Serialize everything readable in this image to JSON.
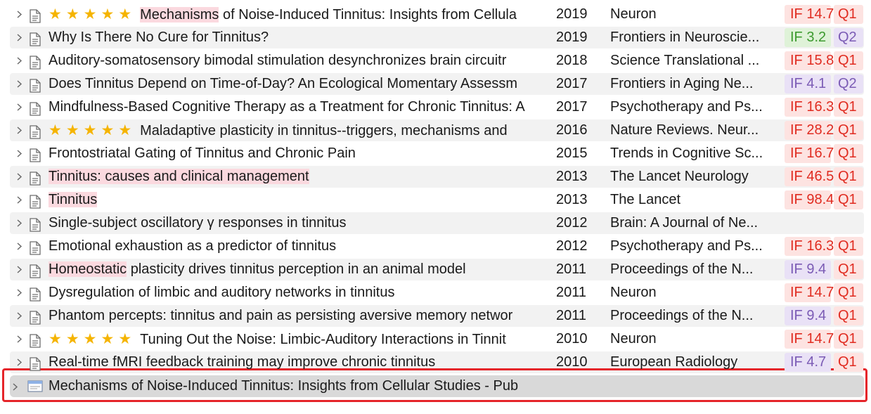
{
  "rows": [
    {
      "stars": 5,
      "title_hl": "Mechanisms",
      "title_rest": " of Noise-Induced Tinnitus: Insights from Cellula",
      "year": "2019",
      "journal": "Neuron",
      "if": "IF 14.7",
      "if_color": "red",
      "q": "Q1",
      "q_color": "red"
    },
    {
      "stars": 0,
      "title_hl": "",
      "title_rest": "Why Is There No Cure for Tinnitus?",
      "year": "2019",
      "journal": "Frontiers in Neuroscie...",
      "if": "IF 3.2",
      "if_color": "green",
      "q": "Q2",
      "q_color": "purple"
    },
    {
      "stars": 0,
      "title_hl": "",
      "title_rest": "Auditory-somatosensory bimodal stimulation desynchronizes brain circuitr",
      "year": "2018",
      "journal": "Science Translational ...",
      "if": "IF 15.8",
      "if_color": "red",
      "q": "Q1",
      "q_color": "red"
    },
    {
      "stars": 0,
      "title_hl": "",
      "title_rest": "Does Tinnitus Depend on Time-of-Day? An Ecological Momentary Assessm",
      "year": "2017",
      "journal": "Frontiers in Aging Ne...",
      "if": "IF 4.1",
      "if_color": "purple",
      "q": "Q2",
      "q_color": "purple"
    },
    {
      "stars": 0,
      "title_hl": "",
      "title_rest": "Mindfulness-Based Cognitive Therapy as a Treatment for Chronic Tinnitus: A",
      "year": "2017",
      "journal": "Psychotherapy and Ps...",
      "if": "IF 16.3",
      "if_color": "red",
      "q": "Q1",
      "q_color": "red"
    },
    {
      "stars": 5,
      "title_hl": "",
      "title_rest": "Maladaptive plasticity in tinnitus--triggers, mechanisms and",
      "year": "2016",
      "journal": "Nature Reviews. Neur...",
      "if": "IF 28.2",
      "if_color": "red",
      "q": "Q1",
      "q_color": "red"
    },
    {
      "stars": 0,
      "title_hl": "",
      "title_rest": "Frontostriatal Gating of Tinnitus and Chronic Pain",
      "year": "2015",
      "journal": "Trends in Cognitive Sc...",
      "if": "IF 16.7",
      "if_color": "red",
      "q": "Q1",
      "q_color": "red"
    },
    {
      "stars": 0,
      "title_hl": "Tinnitus: causes and clinical management",
      "title_rest": "",
      "year": "2013",
      "journal": "The Lancet Neurology",
      "if": "IF 46.5",
      "if_color": "red",
      "q": "Q1",
      "q_color": "red"
    },
    {
      "stars": 0,
      "title_hl": "Tinnitus",
      "title_rest": "",
      "year": "2013",
      "journal": "The Lancet",
      "if": "IF 98.4",
      "if_color": "red",
      "q": "Q1",
      "q_color": "red"
    },
    {
      "stars": 0,
      "title_hl": "",
      "title_rest": "Single-subject oscillatory γ responses in tinnitus",
      "year": "2012",
      "journal": "Brain: A Journal of Ne...",
      "if": "",
      "if_color": "",
      "q": "",
      "q_color": ""
    },
    {
      "stars": 0,
      "title_hl": "",
      "title_rest": "Emotional exhaustion as a predictor of tinnitus",
      "year": "2012",
      "journal": "Psychotherapy and Ps...",
      "if": "IF 16.3",
      "if_color": "red",
      "q": "Q1",
      "q_color": "red"
    },
    {
      "stars": 0,
      "title_hl": "Homeostatic",
      "title_rest": " plasticity drives tinnitus perception in an animal model",
      "year": "2011",
      "journal": "Proceedings of the N...",
      "if": "IF 9.4",
      "if_color": "purple",
      "q": "Q1",
      "q_color": "red"
    },
    {
      "stars": 0,
      "title_hl": "",
      "title_rest": "Dysregulation of limbic and auditory networks in tinnitus",
      "year": "2011",
      "journal": "Neuron",
      "if": "IF 14.7",
      "if_color": "red",
      "q": "Q1",
      "q_color": "red"
    },
    {
      "stars": 0,
      "title_hl": "",
      "title_rest": "Phantom percepts: tinnitus and pain as persisting aversive memory networ",
      "year": "2011",
      "journal": "Proceedings of the N...",
      "if": "IF 9.4",
      "if_color": "purple",
      "q": "Q1",
      "q_color": "red"
    },
    {
      "stars": 5,
      "title_hl": "",
      "title_rest": "Tuning Out the Noise: Limbic-Auditory Interactions in Tinnit",
      "year": "2010",
      "journal": "Neuron",
      "if": "IF 14.7",
      "if_color": "red",
      "q": "Q1",
      "q_color": "red"
    },
    {
      "stars": 0,
      "title_hl": "",
      "title_rest": "Real-time fMRI feedback training may improve chronic tinnitus",
      "year": "2010",
      "journal": "European Radiology",
      "if": "IF 4.7",
      "if_color": "purple",
      "q": "Q1",
      "q_color": "red"
    }
  ],
  "selected_row": {
    "title": "Mechanisms of Noise-Induced Tinnitus: Insights from Cellular Studies - Pub"
  },
  "icons": {
    "expand": "chevron-right-icon",
    "document": "document-icon",
    "web": "web-page-icon",
    "star": "star-icon"
  },
  "colors": {
    "star": "#f5b400",
    "highlight": "#fbd9df",
    "if_red_bg": "#fde3e1",
    "if_red_text": "#e02b20",
    "if_green_bg": "#dff2d8",
    "if_green_text": "#3c9a2e",
    "purple_bg": "#e9e1f6",
    "purple_text": "#7b5bb5",
    "selection": "#d9d9d9",
    "focus_frame": "#e5252a"
  }
}
